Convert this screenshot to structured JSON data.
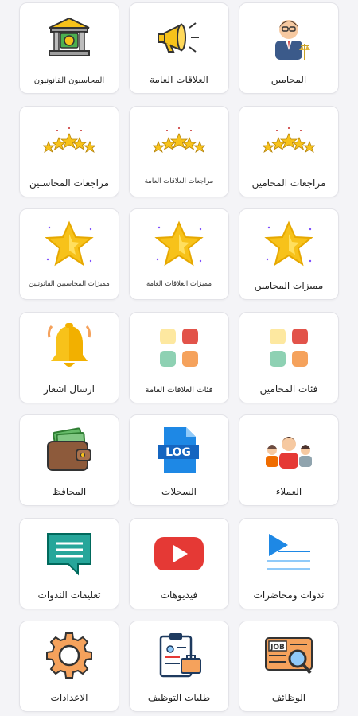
{
  "cards": [
    {
      "label": "المحامين",
      "icon": "lawyer-icon"
    },
    {
      "label": "العلاقات العامة",
      "icon": "megaphone-icon"
    },
    {
      "label": "المحاسبون القانونيون",
      "icon": "bank-icon"
    },
    {
      "label": "مراجعات المحامين",
      "icon": "five-stars-icon"
    },
    {
      "label": "مراجعات العلاقات العامة",
      "icon": "five-stars-icon"
    },
    {
      "label": "مراجعات المحاسبين",
      "icon": "five-stars-icon"
    },
    {
      "label": "مميزات المحامين",
      "icon": "star-icon"
    },
    {
      "label": "مميزات العلاقات العامة",
      "icon": "star-icon"
    },
    {
      "label": "مميزات المحاسبين القانونيين",
      "icon": "star-icon"
    },
    {
      "label": "فئات المحامين",
      "icon": "categories-icon"
    },
    {
      "label": "فئات العلاقات العامة",
      "icon": "categories-icon"
    },
    {
      "label": "ارسال اشعار",
      "icon": "bell-icon"
    },
    {
      "label": "العملاء",
      "icon": "clients-icon"
    },
    {
      "label": "السجلات",
      "icon": "log-file-icon"
    },
    {
      "label": "المحافظ",
      "icon": "wallet-icon"
    },
    {
      "label": "ندوات ومحاضرات",
      "icon": "play-lecture-icon"
    },
    {
      "label": "فيديوهات",
      "icon": "youtube-icon"
    },
    {
      "label": "تعليقات الندوات",
      "icon": "comment-icon"
    },
    {
      "label": "الوظائف",
      "icon": "job-search-icon"
    },
    {
      "label": "طلبات التوظيف",
      "icon": "job-application-icon"
    },
    {
      "label": "الاعدادات",
      "icon": "gear-icon"
    }
  ],
  "colors": {
    "star": "#f7c21a",
    "red": "#e53935",
    "blue": "#1e88e5",
    "teal": "#26a69a",
    "brown": "#8d5a3b"
  }
}
